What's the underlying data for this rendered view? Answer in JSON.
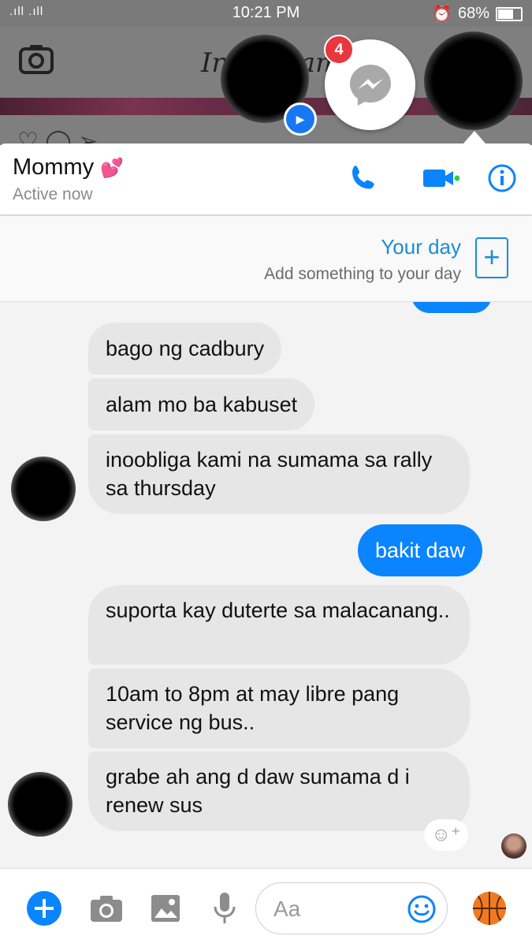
{
  "status_bar": {
    "time": "10:21 PM",
    "signal": ".ıll .ıll",
    "battery": "68%"
  },
  "background_app": {
    "title": "Instagram"
  },
  "chat_heads": {
    "unread_count": "4"
  },
  "chat_header": {
    "contact_name": "Mommy",
    "emoji": "💕",
    "status": "Active now"
  },
  "your_day": {
    "title": "Your day",
    "subtitle": "Add something to your day"
  },
  "messages": [
    {
      "direction": "in",
      "text": "bago ng cadbury"
    },
    {
      "direction": "in",
      "text": "alam mo ba kabuset"
    },
    {
      "direction": "in",
      "text": "inoobliga kami na sumama sa rally sa thursday"
    },
    {
      "direction": "out",
      "text": "bakit daw"
    },
    {
      "direction": "in",
      "text": "suporta kay duterte sa malacanang.."
    },
    {
      "direction": "in",
      "text": "10am to 8pm at may libre pang service ng bus.."
    },
    {
      "direction": "in",
      "text": "grabe ah ang d daw sumama d i renew sus"
    }
  ],
  "composer": {
    "placeholder": "Aa"
  },
  "colors": {
    "accent": "#0a84ff",
    "incoming_bubble": "#e6e6e6",
    "badge": "#e8373e",
    "online": "#2ecc40"
  },
  "icons": [
    "phone-icon",
    "video-icon",
    "info-icon",
    "plus-icon",
    "camera-icon",
    "image-icon",
    "mic-icon",
    "emoji-icon",
    "basketball-icon",
    "messenger-icon"
  ]
}
